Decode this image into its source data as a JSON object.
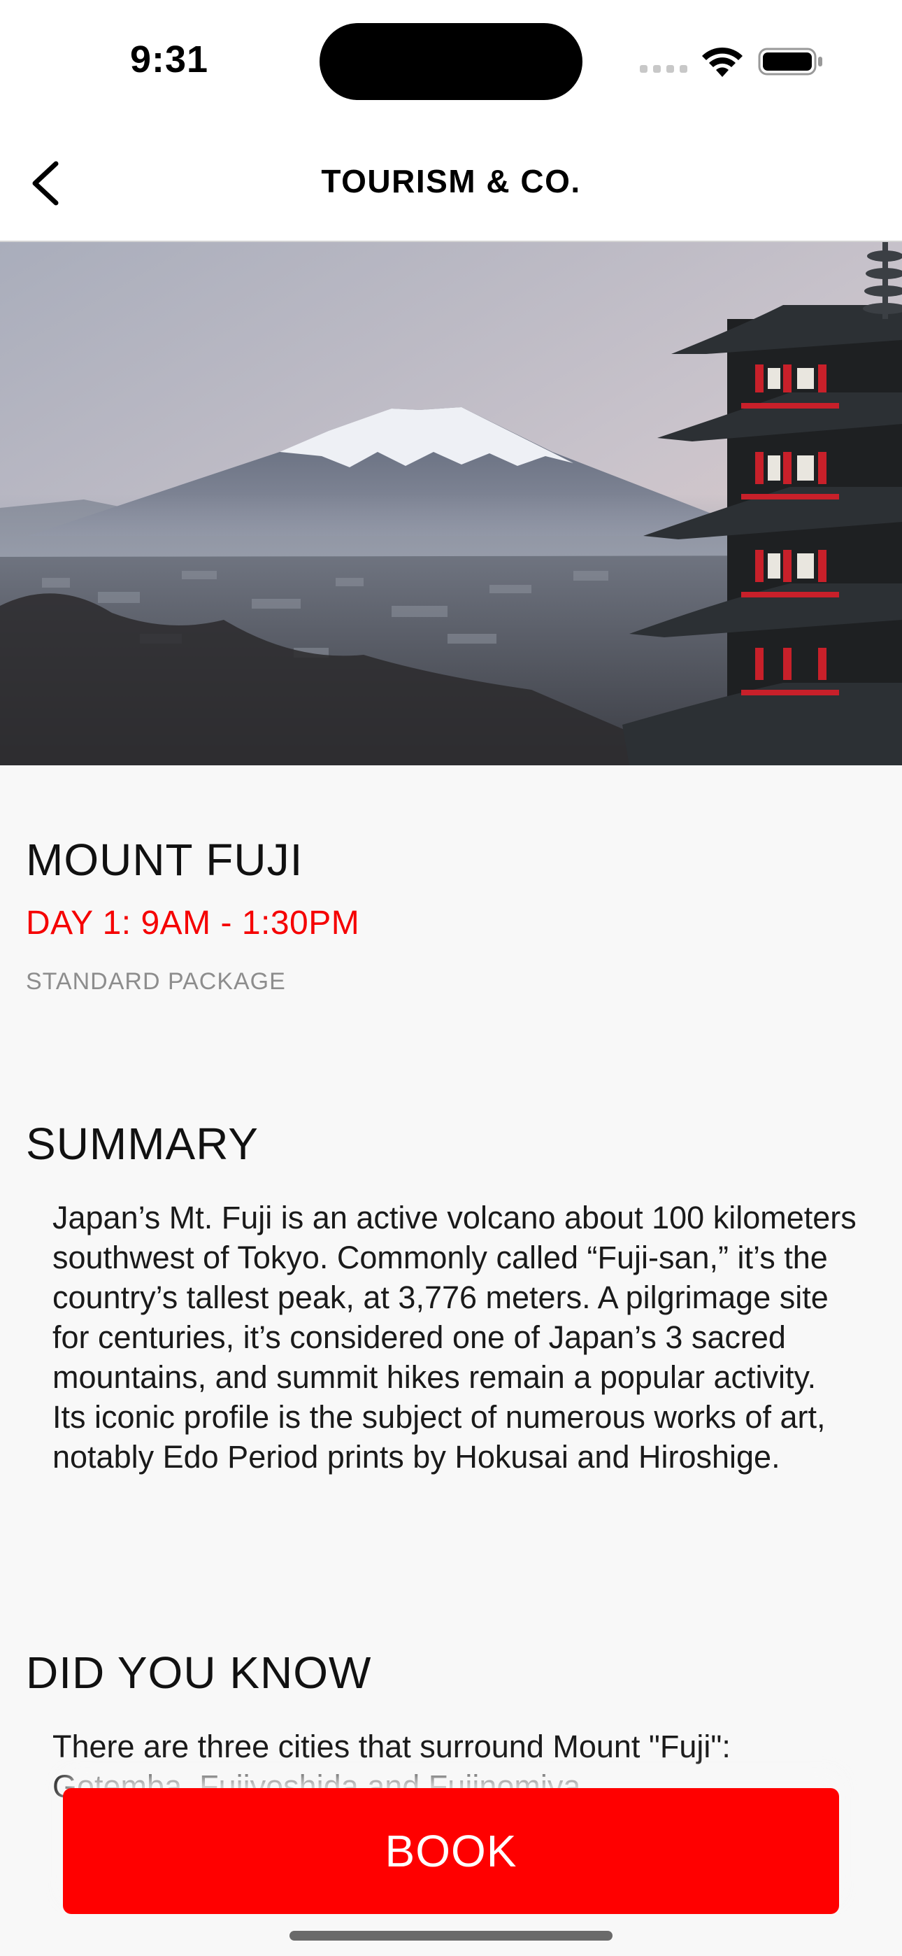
{
  "status_bar": {
    "time": "9:31",
    "icons": [
      "signal-icon",
      "wifi-icon",
      "battery-icon"
    ]
  },
  "nav": {
    "title": "TOURISM & CO.",
    "back_icon": "chevron-left-icon"
  },
  "hero": {
    "image": "photo of Mount Fuji with a red pagoda in the foreground at dusk"
  },
  "detail": {
    "title": "MOUNT FUJI",
    "schedule": "DAY 1: 9AM - 1:30PM",
    "package": "STANDARD PACKAGE",
    "summary_heading": "SUMMARY",
    "summary_text": "Japan’s Mt. Fuji is an active volcano about 100 kilometers southwest of Tokyo. Commonly called “Fuji-san,” it’s the country’s tallest peak, at 3,776 meters. A pilgrimage site for centuries, it’s considered one of Japan’s 3 sacred mountains, and summit hikes remain a popular activity. Its iconic profile is the subject of numerous works of art, notably Edo Period prints by Hokusai and Hiroshige.",
    "did_you_know_heading": "DID YOU KNOW",
    "did_you_know_text": "There are three cities that surround Mount \"Fuji\": Gotemba, Fujiyoshida and Fujinomiya."
  },
  "actions": {
    "book_label": "BOOK"
  },
  "colors": {
    "accent": "#ff0000",
    "schedule": "#f50000",
    "muted": "#8d8d8d",
    "background": "#f8f8f8"
  }
}
